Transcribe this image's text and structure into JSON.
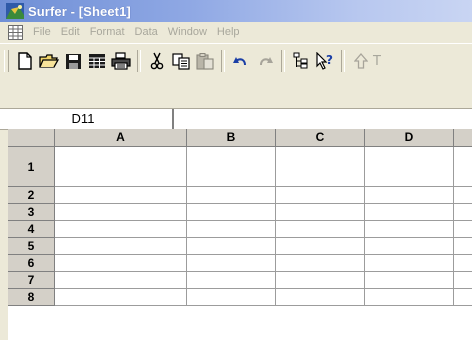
{
  "window": {
    "title": "Surfer - [Sheet1]"
  },
  "menu": {
    "items": [
      "File",
      "Edit",
      "Format",
      "Data",
      "Window",
      "Help"
    ]
  },
  "toolbar": {
    "buttons": [
      "new-document-icon",
      "open-folder-icon",
      "save-disk-icon",
      "worksheet-grid-icon",
      "print-icon",
      "cut-scissors-icon",
      "copy-icon",
      "paste-icon",
      "undo-icon",
      "redo-icon",
      "object-manager-icon",
      "context-help-icon",
      "up-arrow-icon"
    ],
    "trailing_text": "T"
  },
  "formula_bar": {
    "cell_reference": "D11"
  },
  "sheet": {
    "columns": [
      "A",
      "B",
      "C",
      "D"
    ],
    "rows": [
      "1",
      "2",
      "3",
      "4",
      "5",
      "6",
      "7",
      "8"
    ]
  },
  "colors": {
    "title_gradient_start": "#6f8fd6",
    "title_gradient_end": "#c9d5f3",
    "chrome": "#ece9d8",
    "header_gray": "#d4d0c8",
    "disabled_text": "#a8a79c"
  }
}
